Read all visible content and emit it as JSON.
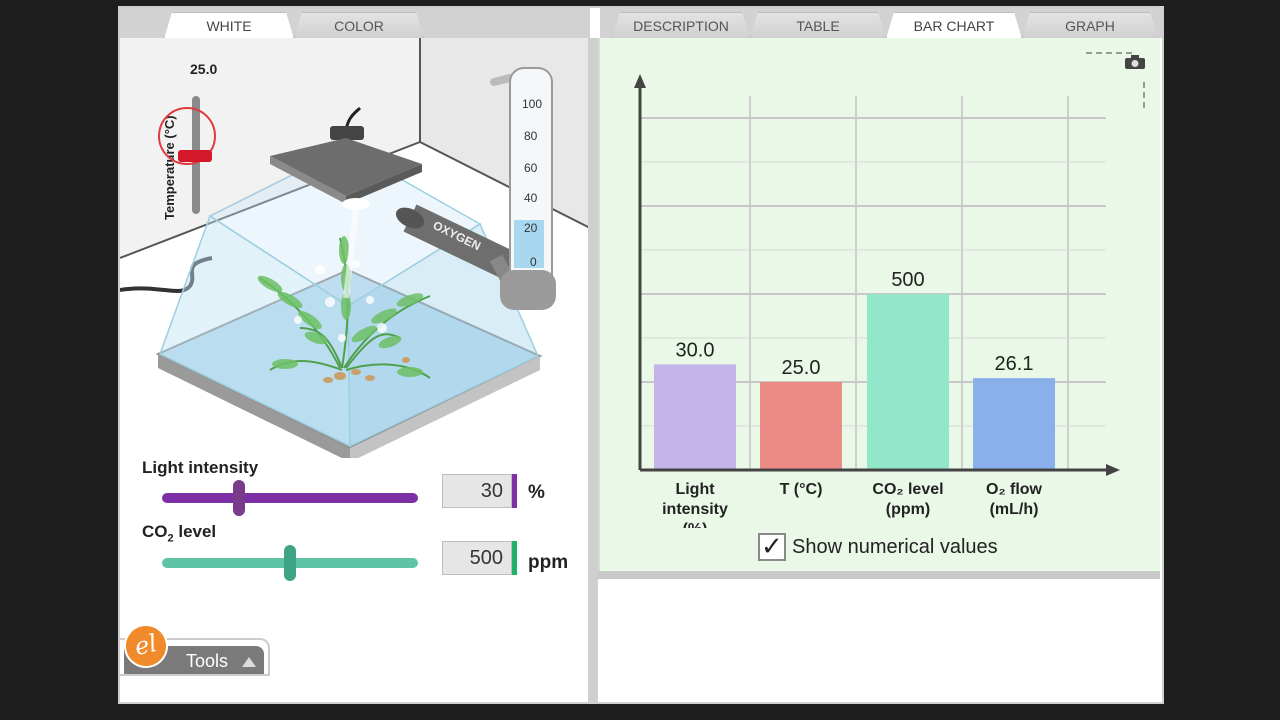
{
  "tabs_left": [
    {
      "label": "WHITE",
      "active": true
    },
    {
      "label": "COLOR",
      "active": false
    }
  ],
  "tabs_right": [
    {
      "label": "DESCRIPTION",
      "active": false
    },
    {
      "label": "TABLE",
      "active": false
    },
    {
      "label": "BAR CHART",
      "active": true
    },
    {
      "label": "GRAPH",
      "active": false
    }
  ],
  "simulation": {
    "temperature_label": "Temperature (°C)",
    "temperature_value": "25.0",
    "tube_label": "OXYGEN",
    "tube_scale": [
      "100",
      "80",
      "60",
      "40",
      "20",
      "0"
    ],
    "oxygen_level_fraction": 0.25
  },
  "controls": {
    "light": {
      "label": "Light intensity",
      "value": "30",
      "unit": "%",
      "fraction": 0.3,
      "color": "#7d2fa5"
    },
    "co2": {
      "label": "CO",
      "sub": "2",
      "label_rest": " level",
      "value": "500",
      "unit": "ppm",
      "fraction": 0.5,
      "color": "#5fc4a6"
    }
  },
  "chart": {
    "show_values_label": "Show numerical values",
    "show_values_checked": true
  },
  "chart_data": {
    "type": "bar",
    "categories": [
      {
        "lines": [
          "Light",
          "intensity",
          "(%)"
        ]
      },
      {
        "lines": [
          "T (°C)"
        ]
      },
      {
        "lines": [
          "CO₂ level",
          "(ppm)"
        ]
      },
      {
        "lines": [
          "O₂ flow",
          "(mL/h)"
        ]
      }
    ],
    "values": [
      30.0,
      25.0,
      500,
      26.1
    ],
    "value_labels": [
      "30.0",
      "25.0",
      "500",
      "26.1"
    ],
    "bar_heights_fraction": [
      0.3,
      0.25,
      0.5,
      0.261
    ],
    "colors": [
      "#c5b4ea",
      "#ec8a86",
      "#92e6c9",
      "#8ab0ec"
    ],
    "grid": true
  },
  "tools": {
    "label": "Tools"
  },
  "logo": {
    "text": "el"
  }
}
